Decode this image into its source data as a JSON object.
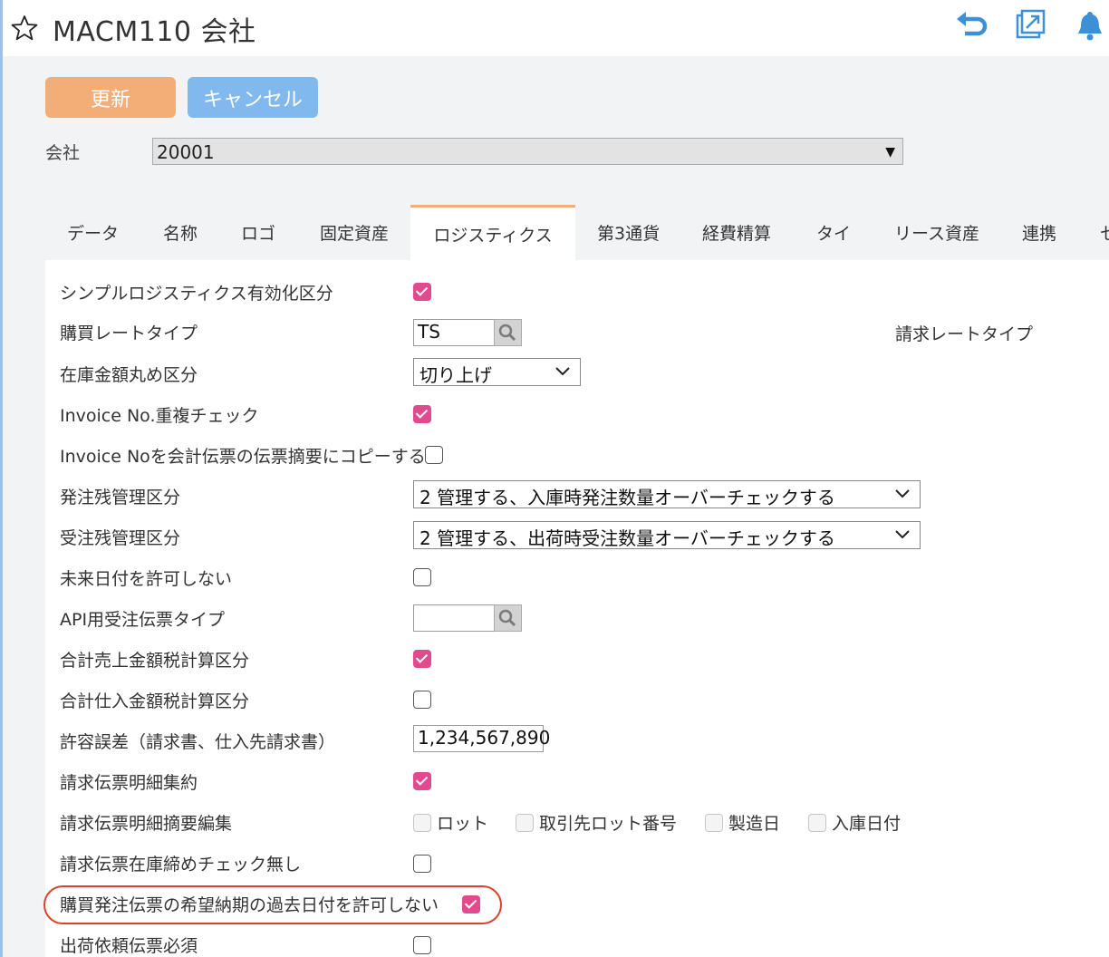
{
  "header": {
    "title": "MACM110 会社",
    "icons": [
      "star-icon",
      "undo-icon",
      "external-link-icon",
      "bell-icon"
    ]
  },
  "toolbar": {
    "update_label": "更新",
    "cancel_label": "キャンセル"
  },
  "company": {
    "label": "会社",
    "value": "20001"
  },
  "tabs": [
    "データ",
    "名称",
    "ロゴ",
    "固定資産",
    "ロジスティクス",
    "第3通貨",
    "経費精算",
    "タイ",
    "リース資産",
    "連携",
    "セ"
  ],
  "active_tab": "ロジスティクス",
  "form": {
    "simple_logistics": {
      "label": "シンプルロジスティクス有効化区分",
      "checked": true
    },
    "purchase_rate_type": {
      "label": "購買レートタイプ",
      "value": "TS"
    },
    "billing_rate_type": {
      "label": "請求レートタイプ"
    },
    "inventory_rounding": {
      "label": "在庫金額丸め区分",
      "value": "切り上げ"
    },
    "invoice_dup_check": {
      "label": "Invoice No.重複チェック",
      "checked": true
    },
    "invoice_copy": {
      "label": "Invoice Noを会計伝票の伝票摘要にコピーする",
      "checked": false
    },
    "po_backorder": {
      "label": "発注残管理区分",
      "value": "2 管理する、入庫時発注数量オーバーチェックする"
    },
    "so_backorder": {
      "label": "受注残管理区分",
      "value": "2 管理する、出荷時受注数量オーバーチェックする"
    },
    "no_future_date": {
      "label": "未来日付を許可しない",
      "checked": false
    },
    "api_so_type": {
      "label": "API用受注伝票タイプ",
      "value": ""
    },
    "sales_tax_calc": {
      "label": "合計売上金額税計算区分",
      "checked": true
    },
    "purchase_tax_calc": {
      "label": "合計仕入金額税計算区分",
      "checked": false
    },
    "tolerance": {
      "label": "許容誤差（請求書、仕入先請求書）",
      "value": "1,234,567,890"
    },
    "billing_detail_summary": {
      "label": "請求伝票明細集約",
      "checked": true
    },
    "billing_detail_desc": {
      "label": "請求伝票明細摘要編集",
      "options": [
        "ロット",
        "取引先ロット番号",
        "製造日",
        "入庫日付"
      ]
    },
    "billing_no_inventory_check": {
      "label": "請求伝票在庫締めチェック無し",
      "checked": false
    },
    "po_no_past_date": {
      "label": "購買発注伝票の希望納期の過去日付を許可しない",
      "checked": true
    },
    "shipping_request_required": {
      "label": "出荷依頼伝票必須",
      "checked": false
    }
  },
  "colors": {
    "accent_update": "#f3ad77",
    "accent_cancel": "#81b9ee",
    "checkbox_on": "#e24a8e",
    "highlight": "#d9432e"
  }
}
